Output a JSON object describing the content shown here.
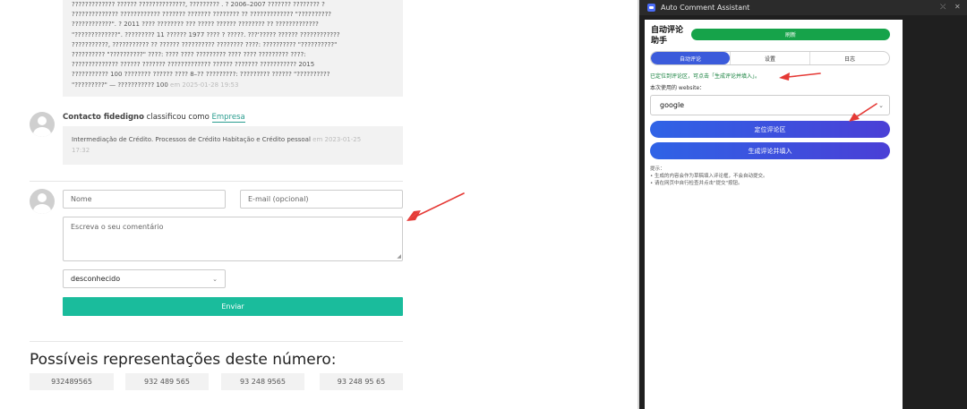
{
  "page": {
    "intro_lines": [
      "?????????????  ?????? ??????????????, ?????????  . ? 2006–2007 ??????? ???????? ?",
      "?????????????? ???????????? ??????? ??????? ???????? ?? ????????????? \"??????????",
      "????????????\". ? 2011 ???? ???????? ??? ????? ?????? ???????? ?? ?????????????",
      "\"?????????????\". ????????? 11 ?????? 1977 ???? ? ?????. ???'????? ?????? ????????????",
      "???????????, ??????????? ?? ?????? ?????????? ???????? ????: ?????????? \"??????????\"",
      "?????????? \"??????????\" ????: ???? ???? ????????? ???? ???? ????????? ????:",
      "?????????????? ?????? ??????? ????????????? ?????? ??????? ??????????? 2015",
      "??????????? 100 ???????? ?????? ???? 8–?? ?????????: ????????? ?????? \"??????????",
      "\"?????????\" — ??????????? 100"
    ],
    "intro_meta": "em 2025-01-28 19:53",
    "comment": {
      "author": "Contacto fidedigno",
      "verb": " classificou como ",
      "category": "Empresa",
      "text": "Intermediação de Crédito. Processos de Crédito Habitação e Crédito pessoal",
      "meta_line1": "em 2023-01-25",
      "meta_line2": "17:32"
    },
    "form": {
      "name_placeholder": "Nome",
      "email_placeholder": "E-mail (opcional)",
      "comment_placeholder": "Escreva o seu comentário",
      "category_value": "desconhecido",
      "send_label": "Enviar"
    },
    "representations_title": "Possíveis representações deste número:",
    "representations": [
      "932489565",
      "932 489 565",
      "93 248 9565",
      "93 248 95 65"
    ]
  },
  "window": {
    "title": "Auto Comment Assistant",
    "pin_glyph": "⤫",
    "close_glyph": "✕",
    "panel": {
      "title": "自动评论助手",
      "refresh_label": "刷新",
      "tabs": [
        "自动评论",
        "设置",
        "日志"
      ],
      "active_tab": "自动评论",
      "status": "已定位到评论区，可点击「生成评论并填入」。",
      "website_label": "本次使用的 website：",
      "website_value": "google",
      "locate_button": "定位评论区",
      "generate_button": "生成评论并填入",
      "tips_title": "提示：",
      "tips": [
        "• 生成的内容会作为草稿填入评论框，不会自动提交。",
        "• 请在网页中自行检查并点击\"提交\"按钮。"
      ]
    }
  },
  "colors": {
    "send_button": "#1abc9c",
    "refresh_button": "#16a34a",
    "primary_button": "#3b5bdb",
    "status_text": "#15803d",
    "annotation_arrow": "#e53935"
  }
}
